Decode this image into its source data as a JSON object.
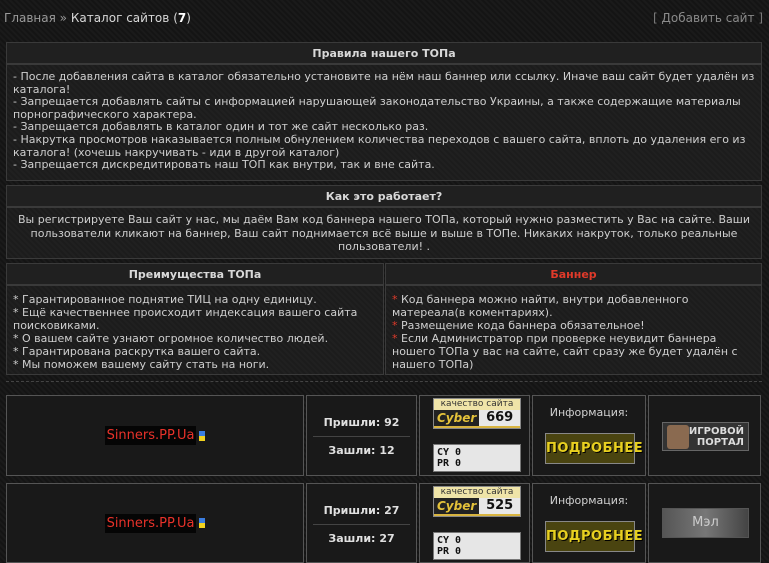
{
  "breadcrumb": {
    "home": "Главная",
    "sep": "»",
    "current": "Каталог сайтов",
    "count_open": "(",
    "count": "7",
    "count_close": ")"
  },
  "add_site": {
    "open": "[",
    "label": "Добавить сайт",
    "close": "]"
  },
  "rules": {
    "title": "Правила нашего ТОПа",
    "lines": [
      "- После добавления сайта в каталог обязательно установите на нём наш баннер или ссылку. Иначе ваш сайт будет удалён из каталога!",
      "- Запрещается добавлять сайты с информацией нарушающей законодательство Украины, а также содержащие материалы порнографического характера.",
      "- Запрещается добавлять в каталог один и тот же сайт несколько раз.",
      "- Накрутка просмотров наказывается полным обнулением количества переходов с вашего сайта, вплоть до удаления его из каталога! (хочешь накручивать - иди в другой каталог)",
      "- Запрещается дискредитировать наш ТОП как внутри, так и вне сайта."
    ]
  },
  "how": {
    "title": "Как это работает?",
    "text": "Вы регистрируете Ваш сайт у нас, мы даём Вам код баннера нашего ТОПа, который нужно разместить у Вас на сайте. Ваши пользователи кликают на баннер, Ваш сайт поднимается всё выше и выше в ТОПе. Никаких накруток, только реальные пользователи! ."
  },
  "advantages": {
    "title": "Преимущества ТОПа",
    "lines": [
      "* Гарантированное поднятие ТИЦ на одну единицу.",
      "* Ещё качественнее происходит индексация вашего сайта поисковиками.",
      "* О вашем сайте узнают огромное количество людей.",
      "* Гарантирована раскрутка вашего сайта.",
      "* Мы поможем вашему сайту стать на ноги."
    ]
  },
  "banner": {
    "title": "Баннер",
    "star": "*",
    "lines": [
      "Код баннера можно найти, внутри добавленного матереала(в коментариях).",
      "Размещение кода баннера обязательное!",
      "Если Администратор при проверке неувидит баннера ношего ТОПа у вас на сайте, сайт сразу же будет удалён с нашего ТОПа)"
    ]
  },
  "colors": {
    "accent_red": "#e03a2a",
    "button_yellow": "#e8d020"
  },
  "sites": [
    {
      "name": "Sinners.PP.Ua",
      "in_label": "Пришли:",
      "in_value": "92",
      "out_label": "Зашли:",
      "out_value": "12",
      "counter_caption": "качество сайта",
      "counter_brand": "Cyber",
      "counter_value": "669",
      "cy_line": "CY 0",
      "pr_line": "PR 0",
      "info_label": "Информация:",
      "more_label": "ПОДРОБНЕЕ",
      "banner_text_1": "ИГРОВОЙ",
      "banner_text_2": "ПОРТАЛ"
    },
    {
      "name": "Sinners.PP.Ua",
      "in_label": "Пришли:",
      "in_value": "27",
      "out_label": "Зашли:",
      "out_value": "27",
      "counter_caption": "качество сайта",
      "counter_brand": "Cyber",
      "counter_value": "525",
      "cy_line": "CY 0",
      "pr_line": "PR 0",
      "info_label": "Информация:",
      "more_label": "ПОДРОБНЕЕ",
      "banner_text_1": "Мэл"
    }
  ]
}
